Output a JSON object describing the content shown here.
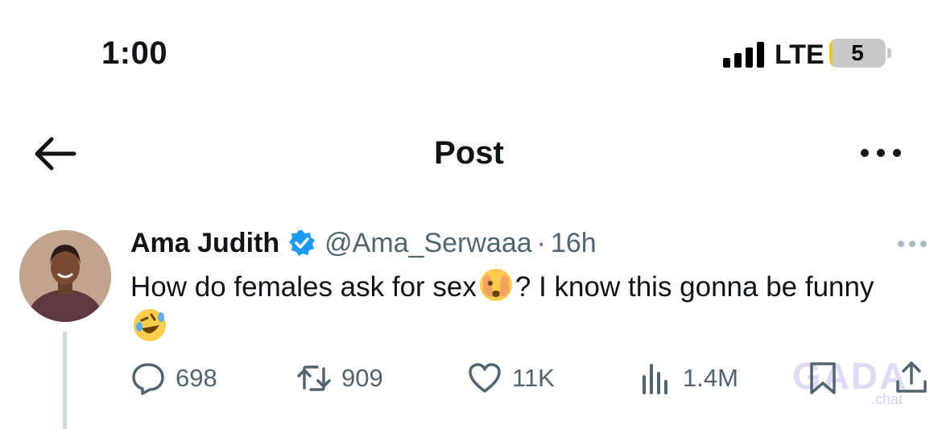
{
  "status_bar": {
    "time": "1:00",
    "network": "LTE",
    "battery_level": "5",
    "battery_fraction": 0.05,
    "signal_bars": 4
  },
  "header": {
    "title": "Post",
    "back_icon": "arrow-left-icon",
    "more_icon": "more-horizontal-icon"
  },
  "post": {
    "author_name": "Ama Judith",
    "verified": true,
    "handle": "@Ama_Serwaaa",
    "separator": "·",
    "time_ago": "16h",
    "text_part1": "How do females ask for sex",
    "text_part2": "? I know this gonna be funny ",
    "emojis": [
      "face-with-peeking-eye",
      "rolling-on-floor-laughing"
    ],
    "actions": {
      "replies": "698",
      "reposts": "909",
      "likes": "11K",
      "views": "1.4M"
    }
  },
  "watermark": {
    "text": "GADA",
    "sub": ".chat"
  },
  "colors": {
    "text": "#0f1419",
    "secondary": "#536471",
    "verified": "#1d9bf0",
    "thread_line": "#cfd9de"
  }
}
